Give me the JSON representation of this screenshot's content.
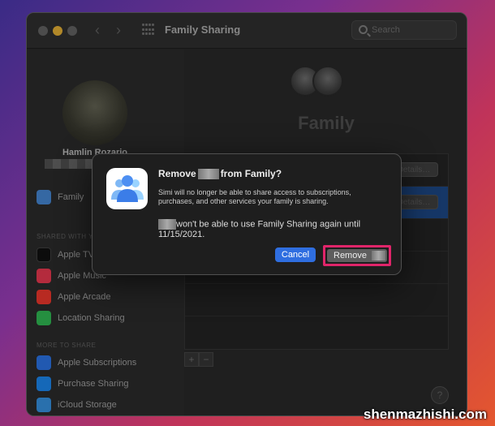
{
  "window": {
    "title": "Family Sharing"
  },
  "search": {
    "placeholder": "Search"
  },
  "sidebar": {
    "user_name": "Hamlin Rozario",
    "items_top": [
      {
        "label": "Family",
        "icon": "family-icon",
        "color": "#4a90e2"
      }
    ],
    "section_shared": "SHARED WITH YOUR FAMILY",
    "items_shared": [
      {
        "label": "Apple TV",
        "icon": "apple-tv-icon",
        "color": "#111111"
      },
      {
        "label": "Apple Music",
        "icon": "apple-music-icon",
        "color": "#fa3c55"
      },
      {
        "label": "Apple Arcade",
        "icon": "apple-arcade-icon",
        "color": "#ff3b30"
      },
      {
        "label": "Location Sharing",
        "icon": "location-sharing-icon",
        "color": "#34c759"
      }
    ],
    "section_more": "MORE TO SHARE",
    "items_more": [
      {
        "label": "Apple Subscriptions",
        "icon": "subscriptions-icon",
        "color": "#2f7cf6"
      },
      {
        "label": "Purchase Sharing",
        "icon": "purchase-sharing-icon",
        "color": "#1e90ff"
      },
      {
        "label": "iCloud Storage",
        "icon": "icloud-icon",
        "color": "#3a9bf0"
      }
    ]
  },
  "main": {
    "family_title": "Family",
    "details_label": "Details…",
    "add_label": "+",
    "remove_label": "−",
    "help_label": "?"
  },
  "dialog": {
    "title_prefix": "Remove",
    "title_suffix": "from Family?",
    "message": "Simi will no longer be able to share access to subscriptions, purchases, and other services your family is sharing.",
    "message2": "won't be able to use Family Sharing again until 11/15/2021.",
    "cancel_label": "Cancel",
    "remove_label": "Remove",
    "highlight_color": "#e0256a",
    "accent_color": "#2f6ee0"
  },
  "watermark": "shenmazhishi.com"
}
